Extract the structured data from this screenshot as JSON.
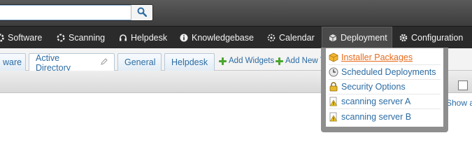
{
  "search": {
    "value": "",
    "placeholder": ""
  },
  "nav": {
    "items": [
      {
        "label": "Software",
        "icon": "software-icon"
      },
      {
        "label": "Scanning",
        "icon": "scanning-icon"
      },
      {
        "label": "Helpdesk",
        "icon": "helpdesk-icon"
      },
      {
        "label": "Knowledgebase",
        "icon": "info-icon"
      },
      {
        "label": "Calendar",
        "icon": "calendar-icon"
      },
      {
        "label": "Deployment",
        "icon": "deployment-icon"
      },
      {
        "label": "Configuration",
        "icon": "gear-icon"
      }
    ]
  },
  "tabs": {
    "items": [
      {
        "label": "ware"
      },
      {
        "label": "Active Directory"
      },
      {
        "label": "General"
      },
      {
        "label": "Helpdesk"
      }
    ],
    "add_widgets": "Add Widgets",
    "add_new_tab": "Add New Ta"
  },
  "show_link": "Show a",
  "deployment_menu": {
    "items": [
      {
        "label": "Installer Packages",
        "icon": "package-icon"
      },
      {
        "label": "Scheduled Deployments",
        "icon": "clock-icon"
      },
      {
        "label": "Security Options",
        "icon": "lock-icon"
      },
      {
        "label": "scanning server A",
        "icon": "warning-document-icon"
      },
      {
        "label": "scanning server B",
        "icon": "warning-document-icon"
      }
    ]
  },
  "colors": {
    "link": "#2c6ca3",
    "hover": "#e86a1a",
    "navbar": "#2b2b2b"
  }
}
